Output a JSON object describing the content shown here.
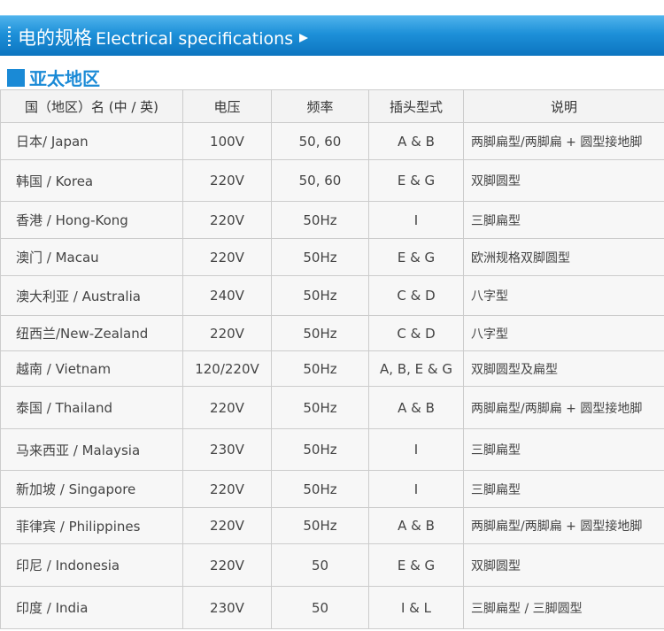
{
  "banner": {
    "title_zh": "电的规格",
    "title_en": "Electrical specifications"
  },
  "region": {
    "title": "亚太地区",
    "accent_color": "#1a8ad6"
  },
  "table": {
    "headers": [
      "国（地区）名 (中 / 英)",
      "电压",
      "频率",
      "插头型式",
      "说明"
    ],
    "rows": [
      [
        "日本/ Japan",
        "100V",
        "50, 60",
        "A & B",
        "两脚扁型/两脚扁 + 圆型接地脚"
      ],
      [
        "韩国 / Korea",
        "220V",
        "50, 60",
        "E & G",
        "双脚圆型"
      ],
      [
        "香港 / Hong-Kong",
        "220V",
        "50Hz",
        "I",
        "三脚扁型"
      ],
      [
        "澳门 / Macau",
        "220V",
        "50Hz",
        "E & G",
        "欧洲规格双脚圆型"
      ],
      [
        "澳大利亚 / Australia",
        "240V",
        "50Hz",
        "C & D",
        "八字型"
      ],
      [
        "纽西兰/New-Zealand",
        "220V",
        "50Hz",
        "C & D",
        "八字型"
      ],
      [
        "越南 / Vietnam",
        "120/220V",
        "50Hz",
        "A, B, E & G",
        "双脚圆型及扁型"
      ],
      [
        "泰国 / Thailand",
        "220V",
        "50Hz",
        "A & B",
        "两脚扁型/两脚扁 + 圆型接地脚"
      ],
      [
        "马来西亚 / Malaysia",
        "230V",
        "50Hz",
        "I",
        "三脚扁型"
      ],
      [
        "新加坡 / Singapore",
        "220V",
        "50Hz",
        "I",
        "三脚扁型"
      ],
      [
        "菲律宾 / Philippines",
        "220V",
        "50Hz",
        "A & B",
        "两脚扁型/两脚扁 + 圆型接地脚"
      ],
      [
        "印尼 / Indonesia",
        "220V",
        "50",
        "E & G",
        "双脚圆型"
      ],
      [
        "印度 / India",
        "230V",
        "50",
        "I & L",
        "三脚扁型 / 三脚圆型"
      ]
    ]
  }
}
